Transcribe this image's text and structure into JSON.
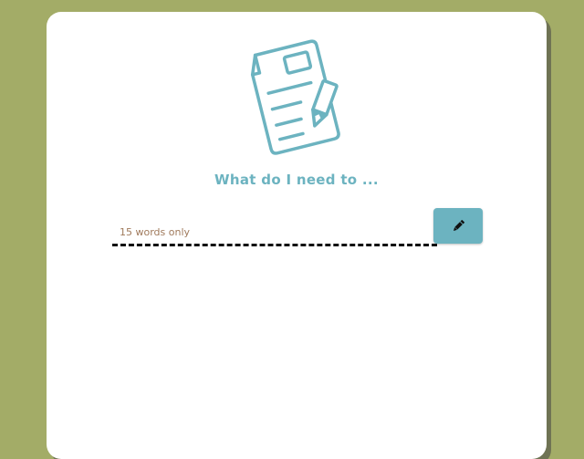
{
  "header": {
    "illustration_icon": "note-with-pencil-icon",
    "headline": "What do I need to ..."
  },
  "form": {
    "input_placeholder": "15 words only",
    "input_value": "",
    "submit_icon": "pencil-icon"
  },
  "colors": {
    "page_background": "#a3ac67",
    "card_background": "#ffffff",
    "accent": "#6cb3c0",
    "placeholder_text": "#a07a5c",
    "underline": "#111111"
  }
}
